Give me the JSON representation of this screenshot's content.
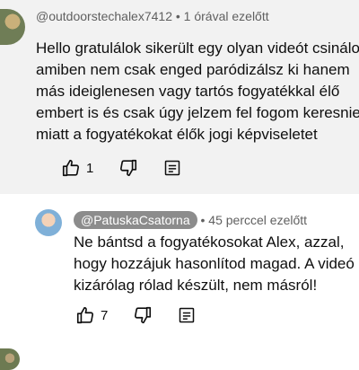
{
  "comments": [
    {
      "handle": "@outdoorstechalex7412",
      "time": "1 órával ezelőtt",
      "text_lines": [
        "Hello gratulálok sikerült egy olyan videót csinálod",
        "amiben nem csak enged paródizálsz ki hanem",
        "más ideiglenesen vagy tartós fogyatékkal élő",
        "embert is és csak úgy jelzem fel fogom keresnie",
        "miatt a fogyatékokat élők jogi képviseletet"
      ],
      "likes": "1"
    },
    {
      "handle": "@PatuskaCsatorna",
      "time": "45 perccel ezelőtt",
      "text_lines": [
        "Ne bántsd a fogyatékosokat Alex, azzal,",
        "hogy hozzájuk hasonlítod magad. A videó",
        "kizárólag rólad készült, nem másról!"
      ],
      "likes": "7"
    }
  ],
  "separator": "•",
  "icons": {
    "like": "thumbs-up-icon",
    "dislike": "thumbs-down-icon",
    "reply": "reply-comment-icon"
  },
  "colors": {
    "highlight_bg": "#f2f2f2",
    "meta_text": "#606060",
    "handle_chip_bg": "#8c8c8c"
  }
}
